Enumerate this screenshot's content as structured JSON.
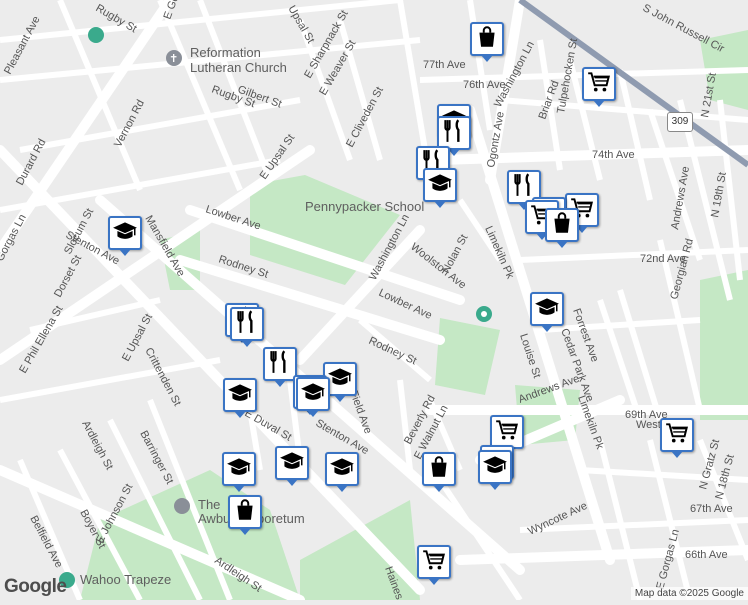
{
  "map": {
    "google_logo": "Google",
    "attribution": "Map data ©2025 Google",
    "route_shield": "309",
    "colors": {
      "park": "#c5e8c5",
      "road": "#ffffff",
      "rail": "#7d8ca3",
      "pin_border": "#3a74c4",
      "route_shield": "#ffffff"
    },
    "street_labels": [
      "Rugby St",
      "E Gorgas Ln",
      "Upsal St",
      "Pleasant Ave",
      "Reformation",
      "Lutheran Church",
      "E Sharpnack St",
      "E Weaver St",
      "Vernon Rd",
      "Gilbert St",
      "Rugby St",
      "Durard Rd",
      "Slocum St",
      "Gorgas Ln",
      "Stenton Ave",
      "Mansfield Ave",
      "Dorset St",
      "E Upsal St",
      "E Upsal St",
      "Lowber Ave",
      "Rodney St",
      "E Phil Ellena St",
      "Crittenden St",
      "E Duval St",
      "Barringer St",
      "Ardleigh St",
      "Belfield Ave",
      "E Johnson St",
      "Boyer St",
      "Ardleigh St",
      "Pennypacker School",
      "Washington Ln",
      "Woolston Ave",
      "Nolan St",
      "Lowber Ave",
      "Rodney St",
      "Limekiln Pk",
      "E Cliveden St",
      "77th Ave",
      "76th Ave",
      "Washington Ln",
      "Ogontz Ave",
      "Briar Rd",
      "Tulpehocken St",
      "S John Russell Cir",
      "N 21st St",
      "74th Ave",
      "72nd Ave",
      "Andrews Ave",
      "N 19th St",
      "Georgian Rd",
      "Forrest Ave",
      "Cedar Park Ave",
      "Louise St",
      "69th Ave",
      "Andrews Ave",
      "Limekiln Pk",
      "Wyncote Ave",
      "Beverly Rd",
      "E Walnut Ln",
      "Stenton Ave",
      "Field Ave",
      "West Oak",
      "N Gratz St",
      "N 18th St",
      "67th Ave",
      "66th Ave",
      "Haines St",
      "Wahoo Trapeze",
      "Awbury Arboretum",
      "The"
    ],
    "places": [
      "Pennypacker School",
      "Reformation Lutheran Church",
      "Awbury Arboretum",
      "Wahoo Trapeze"
    ],
    "markers": [
      {
        "icon": "bag-icon"
      },
      {
        "icon": "cart-icon"
      },
      {
        "icon": "school-icon"
      },
      {
        "icon": "restaurant-icon"
      },
      {
        "icon": "restaurant-icon"
      },
      {
        "icon": "school-icon"
      },
      {
        "icon": "restaurant-icon"
      },
      {
        "icon": "cart-icon"
      },
      {
        "icon": "bag-icon"
      },
      {
        "icon": "cart-icon"
      },
      {
        "icon": "bag-icon"
      },
      {
        "icon": "school-icon"
      },
      {
        "icon": "school-icon"
      },
      {
        "icon": "restaurant-icon"
      },
      {
        "icon": "restaurant-icon"
      },
      {
        "icon": "restaurant-icon"
      },
      {
        "icon": "school-icon"
      },
      {
        "icon": "restaurant-icon"
      },
      {
        "icon": "school-icon"
      },
      {
        "icon": "school-icon"
      },
      {
        "icon": "school-icon"
      },
      {
        "icon": "school-icon"
      },
      {
        "icon": "bag-icon"
      },
      {
        "icon": "school-icon"
      },
      {
        "icon": "cart-icon"
      },
      {
        "icon": "cart-icon"
      },
      {
        "icon": "bag-icon"
      },
      {
        "icon": "school-icon"
      },
      {
        "icon": "cart-icon"
      },
      {
        "icon": "cart-icon"
      }
    ]
  }
}
